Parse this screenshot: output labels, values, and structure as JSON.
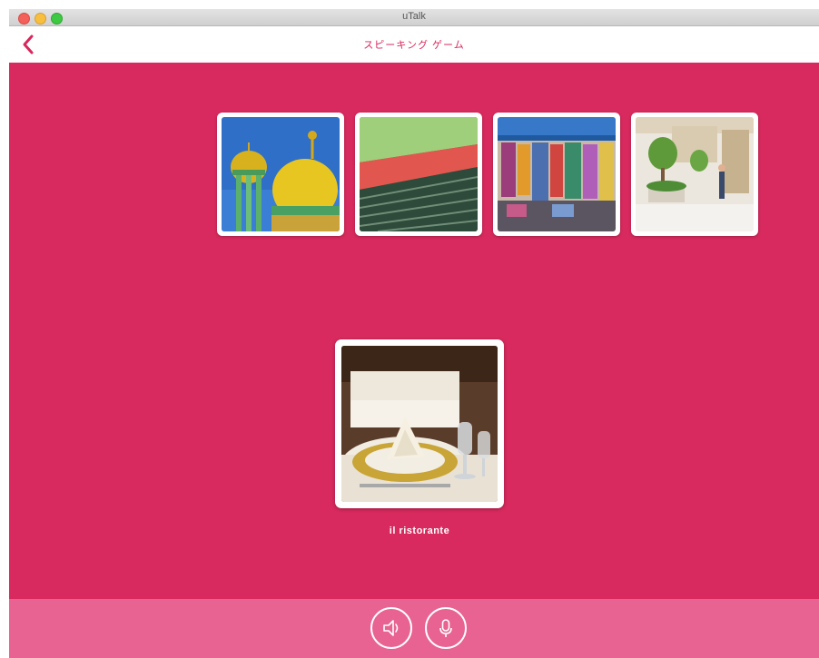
{
  "window": {
    "title": "uTalk"
  },
  "header": {
    "title": "スピーキング ゲーム",
    "back_icon": "chevron-left-icon"
  },
  "thumbnails": [
    {
      "subject": "mosque"
    },
    {
      "subject": "stadium"
    },
    {
      "subject": "market"
    },
    {
      "subject": "shopping-centre"
    }
  ],
  "current": {
    "label": "il ristorante",
    "subject": "restaurant"
  },
  "controls": {
    "speaker_icon": "speaker-icon",
    "mic_icon": "microphone-icon"
  },
  "colors": {
    "accent": "#d82a5e",
    "bottom_bar": "#e86391",
    "header_bg": "#ffffff"
  }
}
